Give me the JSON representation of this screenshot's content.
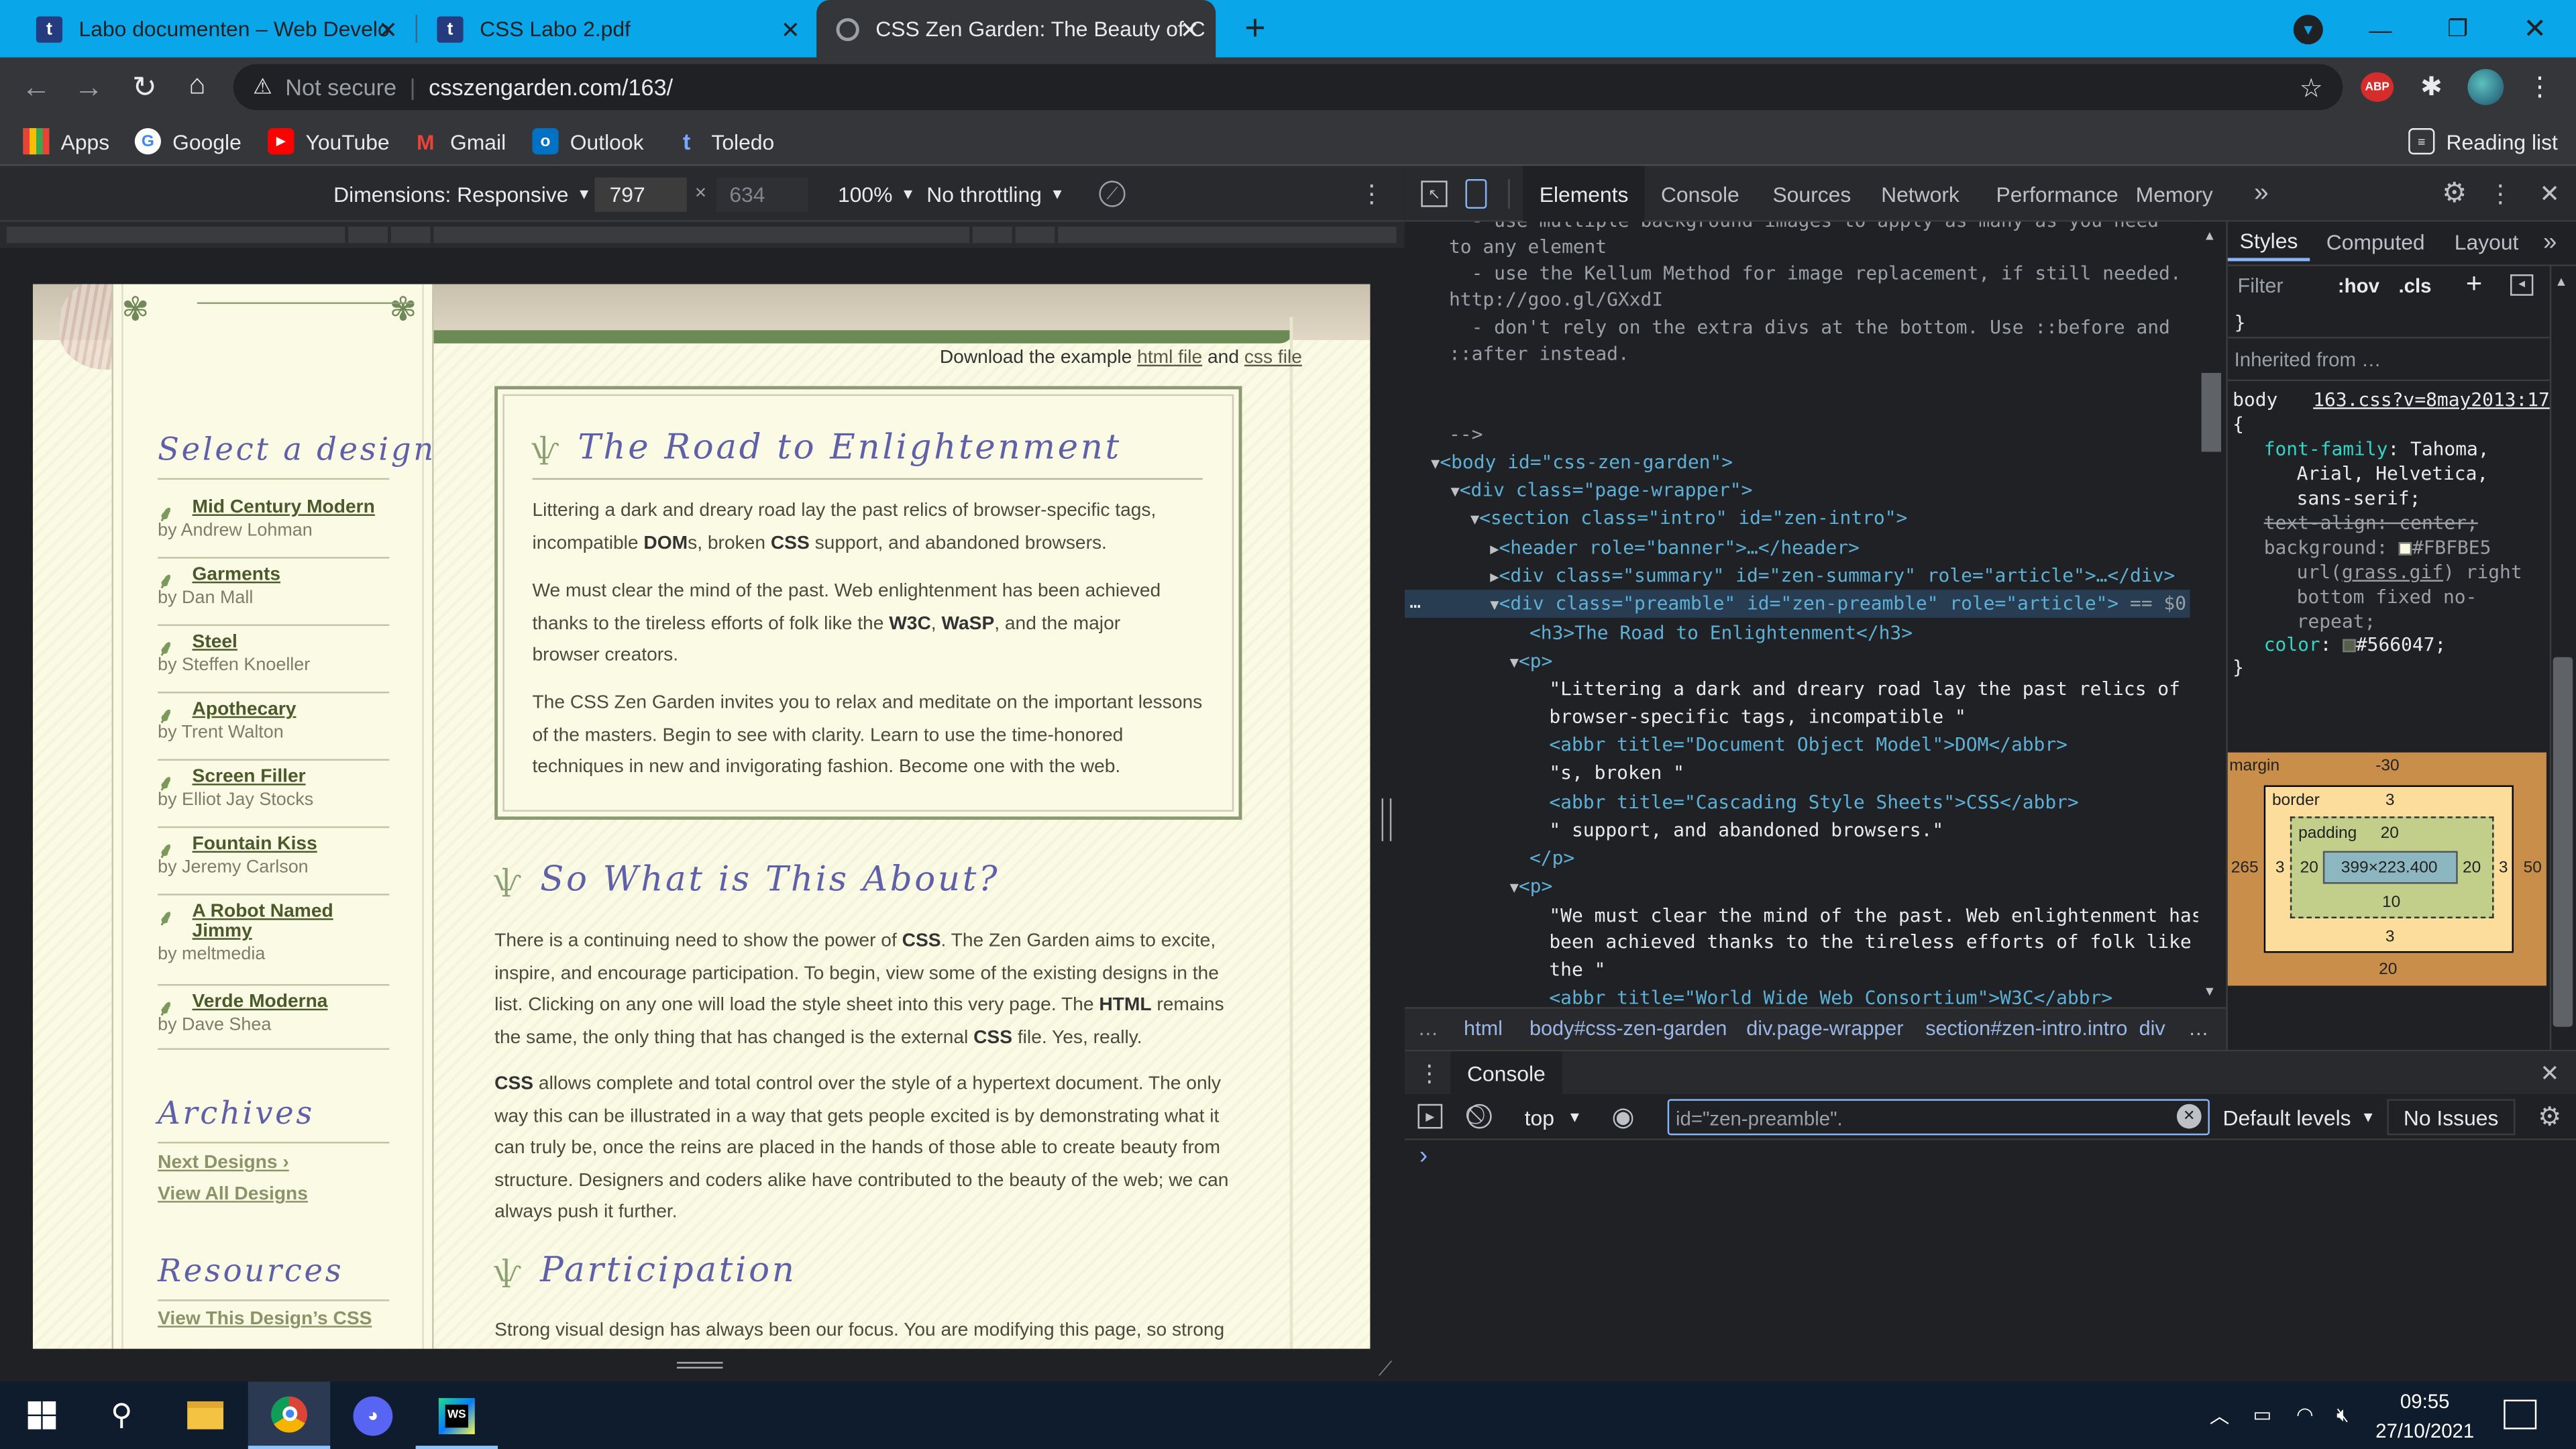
{
  "tabs": [
    {
      "label": "Labo documenten – Web Develo",
      "icon": "t"
    },
    {
      "label": "CSS Labo 2.pdf",
      "icon": "t"
    },
    {
      "label": "CSS Zen Garden: The Beauty of C",
      "icon": "zen"
    }
  ],
  "address": {
    "security": "Not secure",
    "url": "csszengarden.com/163/"
  },
  "bookmarks": [
    "Apps",
    "Google",
    "YouTube",
    "Gmail",
    "Outlook",
    "Toledo"
  ],
  "reading_list": "Reading list",
  "abp": "ABP",
  "device": {
    "dimensions": "Dimensions: Responsive",
    "width": "797",
    "height": "634",
    "zoom": "100%",
    "throttle": "No throttling"
  },
  "page": {
    "download": {
      "prefix": "Download the example ",
      "html": "html file",
      "and": " and ",
      "css": "css file"
    },
    "select_design": "Select a design",
    "designs": [
      {
        "name": "Mid Century Modern",
        "author": "by Andrew Lohman"
      },
      {
        "name": "Garments",
        "author": "by Dan Mall"
      },
      {
        "name": "Steel",
        "author": "by Steffen Knoeller"
      },
      {
        "name": "Apothecary",
        "author": "by Trent Walton"
      },
      {
        "name": "Screen Filler",
        "author": "by Elliot Jay Stocks"
      },
      {
        "name": "Fountain Kiss",
        "author": "by Jeremy Carlson"
      },
      {
        "name": "A Robot Named Jimmy",
        "author": "by meltmedia"
      },
      {
        "name": "Verde Moderna",
        "author": "by Dave Shea"
      }
    ],
    "archives": "Archives",
    "next_designs": "Next Designs ›",
    "view_all": "View All Designs",
    "resources": "Resources",
    "view_css": "View This Design’s CSS",
    "preamble_title": "The Road to Enlightenment",
    "p1": [
      "Littering a dark and dreary road lay the past relics of browser-specific tags,",
      "incompatible ",
      "DOM",
      "s, broken ",
      "CSS",
      " support, and abandoned browsers."
    ],
    "p2": [
      "We must clear the mind of the past. Web enlightenment has been achieved",
      "thanks to the tireless efforts of folk like the ",
      "W3C",
      ", ",
      "WaSP",
      ", and the major",
      "browser creators."
    ],
    "p3": [
      "The CSS Zen Garden invites you to relax and meditate on the important lessons",
      "of the masters. Begin to see with clarity. Learn to use the time-honored",
      "techniques in new and invigorating fashion. Become one with the web."
    ],
    "about_title": "So What is This About?",
    "a1": [
      "There is a continuing need to show the power of ",
      "CSS",
      ". The Zen Garden aims to excite,",
      "inspire, and encourage participation. To begin, view some of the existing designs in the",
      "list. Clicking on any one will load the style sheet into this very page. The ",
      "HTML",
      " remains",
      "the same, the only thing that has changed is the external ",
      "CSS",
      " file. Yes, really."
    ],
    "a2": [
      "CSS",
      " allows complete and total control over the style of a hypertext document. The only",
      "way this can be illustrated in a way that gets people excited is by demonstrating what it",
      "can truly be, once the reins are placed in the hands of those able to create beauty from",
      "structure. Designers and coders alike have contributed to the beauty of the web; we can",
      "always push it further."
    ],
    "participation_title": "Participation",
    "part1": "Strong visual design has always been our focus. You are modifying this page, so strong"
  },
  "devtools": {
    "tabs": [
      "Elements",
      "Console",
      "Sources",
      "Network",
      "Performance",
      "Memory"
    ],
    "code": [
      "  - use multiple background images to apply as many as you need",
      "to any element",
      "  - use the Kellum Method for image replacement, if still needed.",
      "http://goo.gl/GXxdI",
      "  - don't rely on the extra divs at the bottom. Use ::before and",
      "::after instead.",
      "-->"
    ],
    "dom": {
      "body": "<body id=\"css-zen-garden\">",
      "wrapper": "<div class=\"page-wrapper\">",
      "section": "<section class=\"intro\" id=\"zen-intro\">",
      "header": "<header role=\"banner\">…</header>",
      "summary": "<div class=\"summary\" id=\"zen-summary\" role=\"article\">…</div>",
      "preamble": "<div class=\"preamble\" id=\"zen-preamble\" role=\"article\">",
      "sel": " == $0",
      "h3": "<h3>The Road to Enlightenment</h3>",
      "p_open": "<p>",
      "t1a": "\"Littering a dark and dreary road lay the past relics of",
      "t1b": "browser-specific tags, incompatible \"",
      "abbr1": "<abbr title=\"Document Object Model\">DOM</abbr>",
      "t2": "\"s, broken \"",
      "abbr2": "<abbr title=\"Cascading Style Sheets\">CSS</abbr>",
      "t3": "\" support, and abandoned browsers.\"",
      "p_close": "</p>",
      "p_open2": "<p>",
      "t4a": "\"We must clear the mind of the past. Web enlightenment has",
      "t4b": "been achieved thanks to the tireless efforts of folk like",
      "t4c": "the \"",
      "abbr3": "<abbr title=\"World Wide Web Consortium\">W3C</abbr>"
    },
    "breadcrumbs": [
      "html",
      "body#css-zen-garden",
      "div.page-wrapper",
      "section#zen-intro.intro",
      "div"
    ],
    "styles": {
      "tabs": [
        "Styles",
        "Computed",
        "Layout"
      ],
      "filter": "Filter",
      "hov": ":hov",
      "cls": ".cls",
      "brace": "}",
      "inherited": "Inherited from …",
      "selector": "body",
      "source": "163.css?v=8may2013:17",
      "open": "{",
      "font_family_name": "font-family",
      "font_family_value": "Tahoma,",
      "ff2": "Arial, Helvetica,",
      "ff3": "sans-serif;",
      "text_align": "text-align: center;",
      "bg_name": "background",
      "bg_value": "#FBFBE5",
      "bg2a": "url(",
      "bg2b": "grass.gif",
      "bg2c": ") right",
      "bg3": "bottom fixed no-",
      "bg4": "repeat;",
      "color_name": "color",
      "color_value": "#566047;",
      "close": "}"
    },
    "boxmodel": {
      "margin": "margin",
      "margin_top": "-30",
      "margin_left": "265",
      "margin_right": "50",
      "margin_bottom": "20",
      "border": "border",
      "border_top": "3",
      "border_left": "3",
      "border_right": "3",
      "border_bottom": "3",
      "padding": "padding",
      "pad_top": "20",
      "pad_left": "20",
      "pad_right": "20",
      "pad_bottom": "10",
      "content": "399×223.400"
    },
    "console": {
      "title": "Console",
      "context": "top",
      "filter": "id=\"zen-preamble\".",
      "levels": "Default levels",
      "issues": "No Issues",
      "prompt": "›"
    }
  },
  "taskbar": {
    "time": "09:55",
    "date": "27/10/2021"
  },
  "colors": {
    "tabstrip": "#09a6ea",
    "page_bg": "#FBFBE5",
    "text": "#566047",
    "script_heading": "#5f60a8"
  }
}
